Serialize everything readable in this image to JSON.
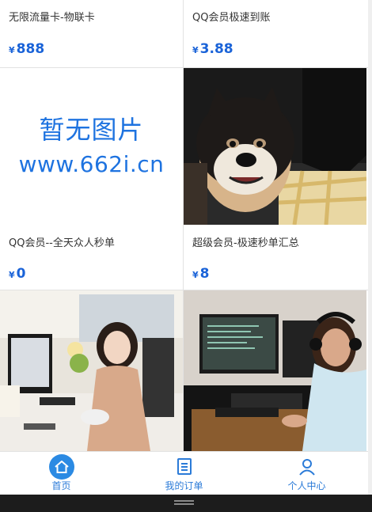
{
  "products": [
    {
      "title": "无限流量卡-物联卡",
      "currency": "¥",
      "price": "888"
    },
    {
      "title": "QQ会员极速到账",
      "currency": "¥",
      "price": "3.88"
    },
    {
      "title": "QQ会员--全天众人秒单",
      "currency": "¥",
      "price": "0",
      "image_text_line1": "暂无图片",
      "image_text_line2": "www.662i.cn"
    },
    {
      "title": "超级会员-极速秒单汇总",
      "currency": "¥",
      "price": "8"
    }
  ],
  "tabs": [
    {
      "label": "首页",
      "icon": "home-icon"
    },
    {
      "label": "我的订单",
      "icon": "order-list-icon"
    },
    {
      "label": "个人中心",
      "icon": "user-icon"
    }
  ],
  "colors": {
    "accent": "#1a63d8",
    "tab_active": "#2b7bd8"
  }
}
